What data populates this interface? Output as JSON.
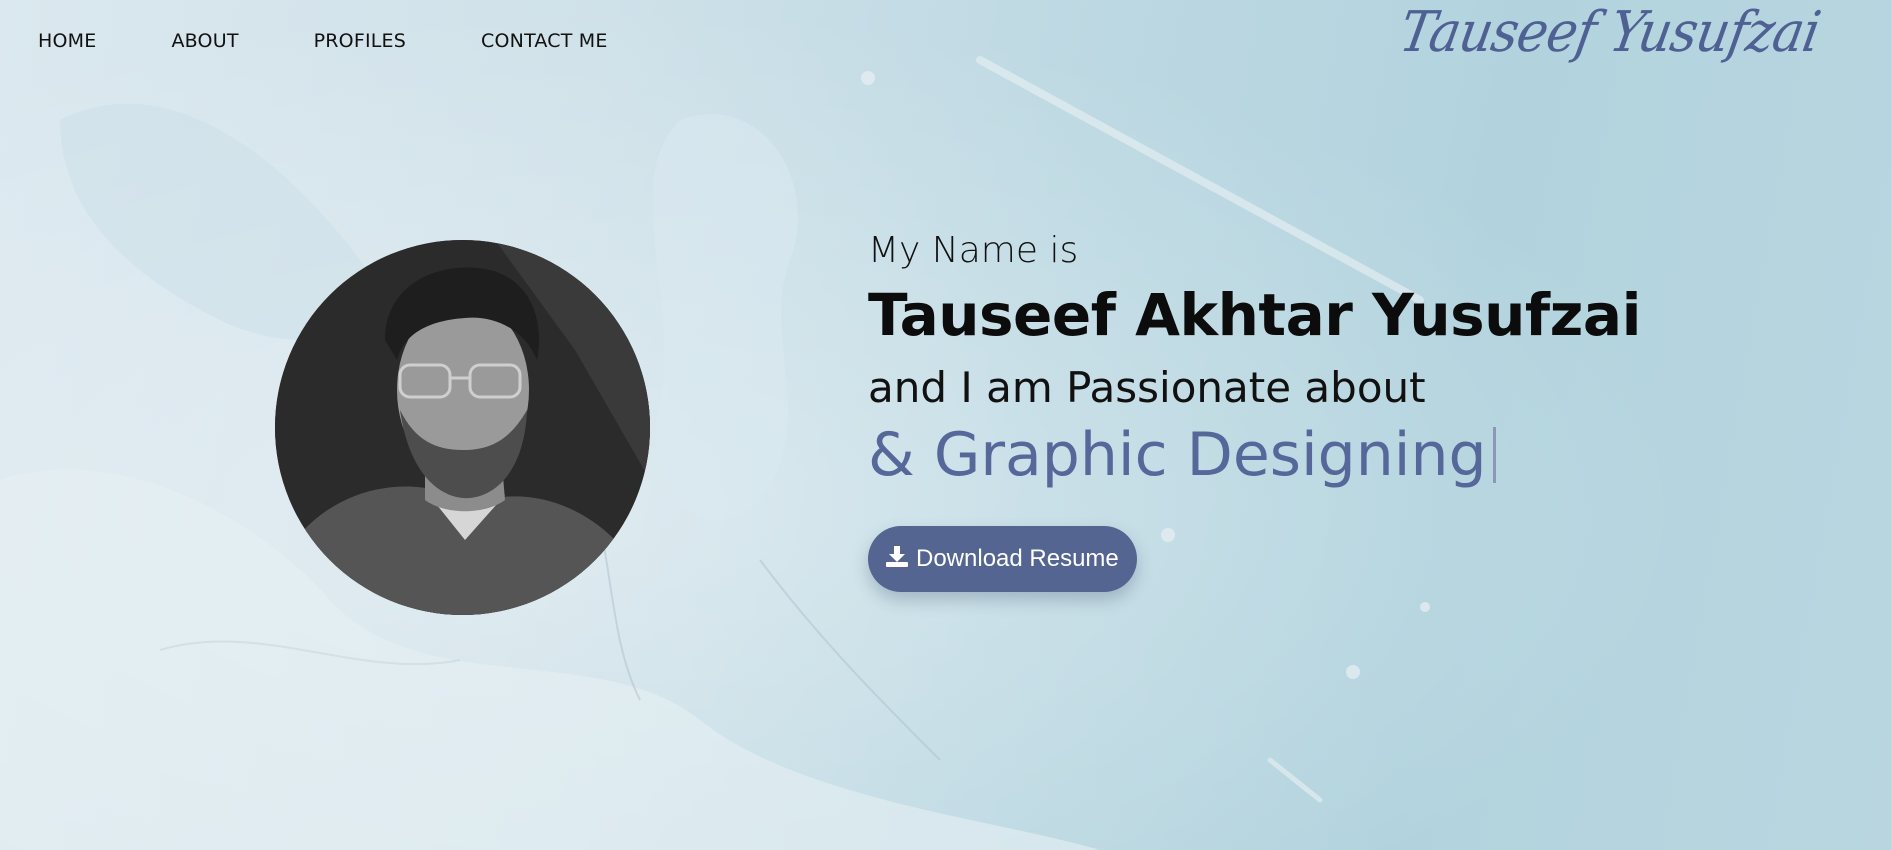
{
  "nav": {
    "items": [
      {
        "label": "HOME"
      },
      {
        "label": "ABOUT"
      },
      {
        "label": "PROFILES"
      },
      {
        "label": "CONTACT ME"
      }
    ]
  },
  "logo": {
    "text": "Tauseef Yusufzai"
  },
  "hero": {
    "intro": "My Name is",
    "name": "Tauseef Akhtar Yusufzai",
    "passion_intro": "and I am Passionate about",
    "typed_text": "& Graphic Designing",
    "download_button": "Download Resume",
    "download_icon": "download-icon"
  },
  "colors": {
    "accent": "#536590",
    "typed_text": "#56679a",
    "logo": "#4f6193"
  }
}
